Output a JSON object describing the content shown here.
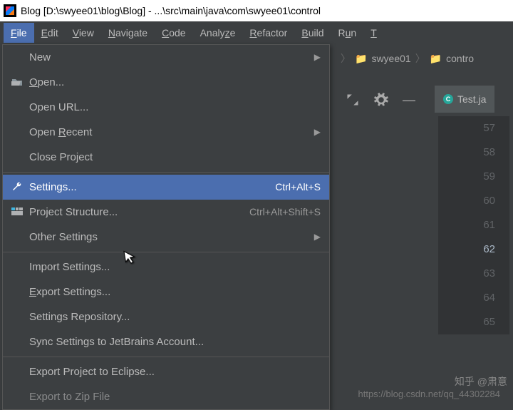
{
  "title": "Blog [D:\\swyee01\\blog\\Blog] - ...\\src\\main\\java\\com\\swyee01\\control",
  "menubar": {
    "file": "File",
    "edit": "Edit",
    "view": "View",
    "navigate": "Navigate",
    "code": "Code",
    "analyze": "Analyze",
    "refactor": "Refactor",
    "build": "Build",
    "run": "Run",
    "t": "T"
  },
  "dropdown": {
    "new": "New",
    "open": "Open...",
    "open_url": "Open URL...",
    "open_recent": "Open Recent",
    "close_project": "Close Project",
    "settings": "Settings...",
    "settings_sc": "Ctrl+Alt+S",
    "project_structure": "Project Structure...",
    "project_structure_sc": "Ctrl+Alt+Shift+S",
    "other_settings": "Other Settings",
    "import_settings": "Import Settings...",
    "export_settings": "Export Settings...",
    "settings_repo": "Settings Repository...",
    "sync_jetbrains": "Sync Settings to JetBrains Account...",
    "export_eclipse": "Export Project to Eclipse...",
    "export_zip": "Export to Zip File"
  },
  "breadcrumb": {
    "b1": "swyee01",
    "b2": "contro"
  },
  "tab": {
    "name": "Test.ja"
  },
  "gutter": {
    "lines": [
      "57",
      "58",
      "59",
      "60",
      "61",
      "62",
      "63",
      "64",
      "65"
    ],
    "current": "62"
  },
  "watermark": "https://blog.csdn.net/qq_44302284",
  "watermark2": "知乎 @肃意"
}
